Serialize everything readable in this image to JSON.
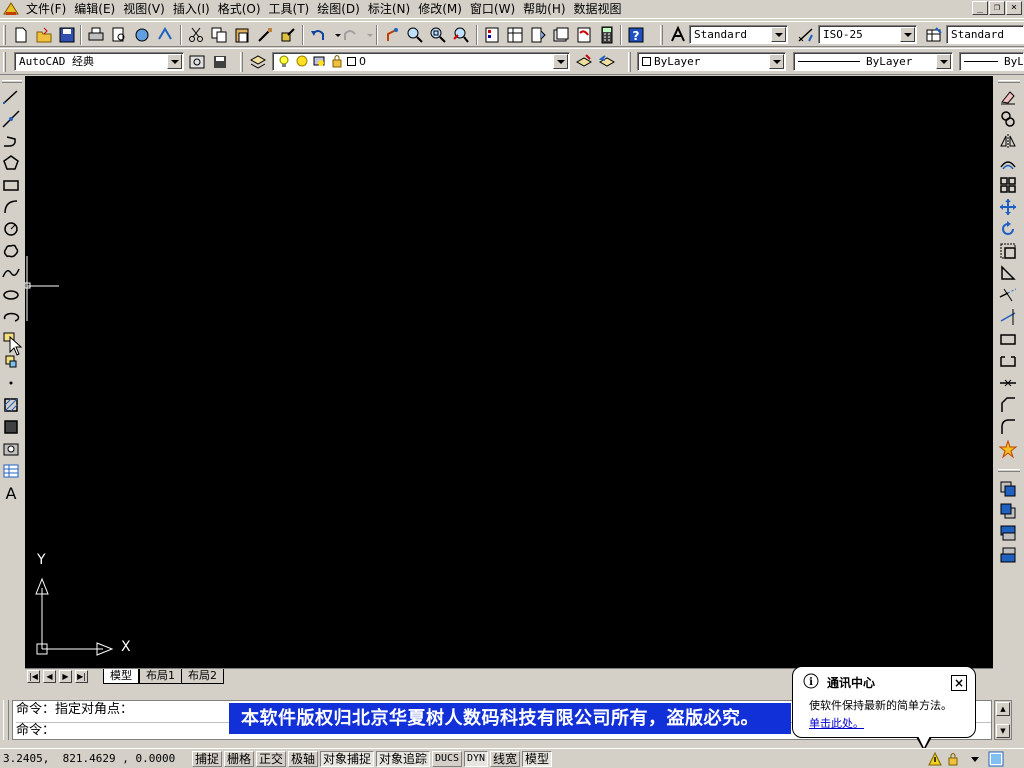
{
  "menubar": {
    "items": [
      "文件(F)",
      "编辑(E)",
      "视图(V)",
      "插入(I)",
      "格式(O)",
      "工具(T)",
      "绘图(D)",
      "标注(N)",
      "修改(M)",
      "窗口(W)",
      "帮助(H)",
      "数据视图"
    ],
    "window_buttons": [
      "_",
      "❐",
      "×"
    ]
  },
  "toolbar_standard": {
    "text_style": "Standard",
    "dim_style": "ISO-25",
    "table_style": "Standard"
  },
  "toolbar_layers": {
    "workspace": "AutoCAD 经典",
    "layer": "0",
    "color": "ByLayer",
    "linetype": "ByLayer",
    "lineweight": "ByL"
  },
  "canvas": {
    "background": "#000000",
    "ucs_y_label": "Y",
    "ucs_x_label": "X"
  },
  "layout_tabs": [
    "模型",
    "布局1",
    "布局2"
  ],
  "command": {
    "line1": "命令：指定对角点：",
    "line2": "命令：",
    "banner": "本软件版权归北京华夏树人数码科技有限公司所有，盗版必究。",
    "banner_color": "#1230d8"
  },
  "statusbar": {
    "coords": "3.2405,  821.4629 , 0.0000",
    "toggles": [
      "捕捉",
      "栅格",
      "正交",
      "极轴",
      "对象捕捉",
      "对象追踪",
      "DUCS",
      "DYN",
      "线宽",
      "模型"
    ]
  },
  "balloon": {
    "title": "通讯中心",
    "body": "使软件保持最新的简单方法。",
    "link": "单击此处。",
    "close": "×"
  }
}
